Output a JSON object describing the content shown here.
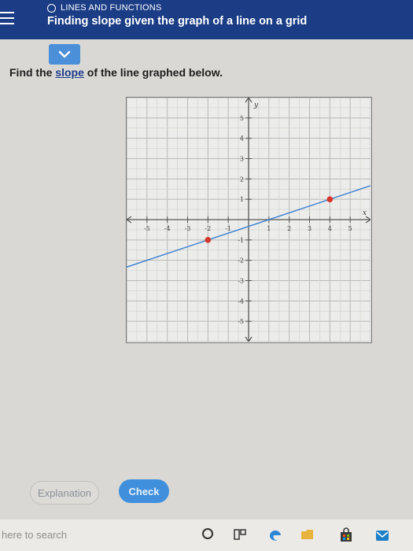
{
  "header": {
    "topic": "LINES AND FUNCTIONS",
    "title": "Finding slope given the graph of a line on a grid"
  },
  "question": {
    "prefix": "Find the ",
    "link": "slope",
    "suffix": " of the line graphed below."
  },
  "graph": {
    "x_axis_label": "x",
    "y_axis_label": "y",
    "x_ticks": [
      "-5",
      "-4",
      "-3",
      "-2",
      "-1",
      "1",
      "2",
      "3",
      "4",
      "5"
    ],
    "y_ticks": [
      "5",
      "4",
      "3",
      "2",
      "1",
      "-1",
      "-2",
      "-3",
      "-4",
      "-5"
    ],
    "point_a": [
      -2,
      -1
    ],
    "point_b": [
      4,
      1
    ],
    "line_color": "#3a7fd0",
    "point_color": "#d8352b"
  },
  "buttons": {
    "explanation": "Explanation",
    "check": "Check"
  },
  "taskbar": {
    "search_placeholder": "here to search"
  }
}
